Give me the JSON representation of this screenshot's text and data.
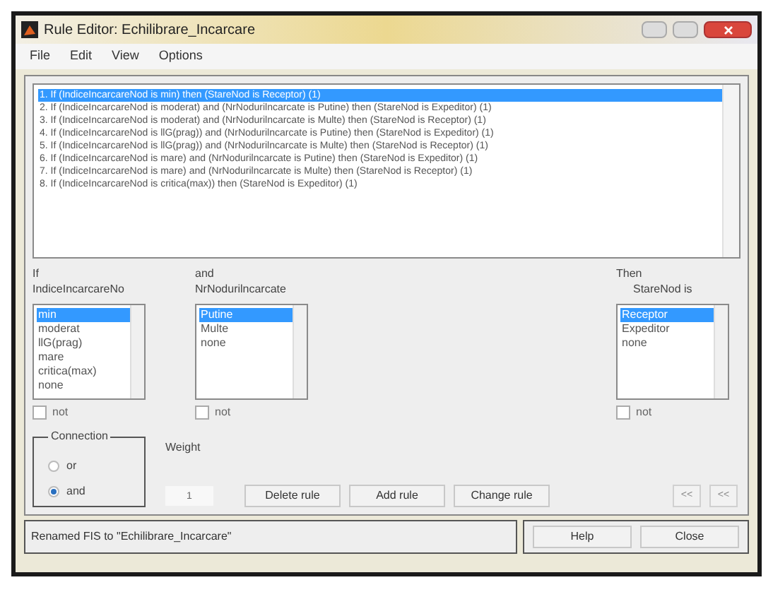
{
  "window": {
    "title": "Rule Editor: Echilibrare_Incarcare"
  },
  "menu": [
    "File",
    "Edit",
    "View",
    "Options"
  ],
  "rules": [
    {
      "text": "1. If (IndiceIncarcareNod is min) then (StareNod is Receptor) (1)",
      "selected": true
    },
    {
      "text": "2. If (IndiceIncarcareNod is moderat) and (NrNodurilncarcate is Putine) then (StareNod is Expeditor) (1)",
      "selected": false
    },
    {
      "text": "3. If (IndiceIncarcareNod is moderat) and (NrNodurilncarcate is Multe) then (StareNod is Receptor) (1)",
      "selected": false
    },
    {
      "text": "4. If (IndiceIncarcareNod is llG(prag)) and (NrNodurilncarcate is Putine) then (StareNod is Expeditor) (1)",
      "selected": false
    },
    {
      "text": "5. If (IndiceIncarcareNod is llG(prag)) and (NrNodurilncarcate is Multe) then (StareNod is Receptor) (1)",
      "selected": false
    },
    {
      "text": "6. If (IndiceIncarcareNod is mare) and (NrNodurilncarcate is Putine) then (StareNod is Expeditor) (1)",
      "selected": false
    },
    {
      "text": "7. If (IndiceIncarcareNod is mare) and (NrNodurilncarcate is Multe) then (StareNod is Receptor) (1)",
      "selected": false
    },
    {
      "text": "8. If (IndiceIncarcareNod is critica(max)) then (StareNod is Expeditor) (1)",
      "selected": false
    }
  ],
  "inputs": [
    {
      "prefix": "If",
      "name": "IndiceIncarcareNo",
      "not_label": "not",
      "not_checked": false,
      "options": [
        {
          "label": "min",
          "selected": true
        },
        {
          "label": "moderat",
          "selected": false
        },
        {
          "label": "llG(prag)",
          "selected": false
        },
        {
          "label": "mare",
          "selected": false
        },
        {
          "label": "critica(max)",
          "selected": false
        },
        {
          "label": "none",
          "selected": false
        }
      ]
    },
    {
      "prefix": "and",
      "name": "NrNodurilncarcate",
      "not_label": "not",
      "not_checked": false,
      "options": [
        {
          "label": "Putine",
          "selected": true
        },
        {
          "label": "Multe",
          "selected": false
        },
        {
          "label": "none",
          "selected": false
        }
      ]
    }
  ],
  "output": {
    "prefix": "Then",
    "name": "StareNod is",
    "not_label": "not",
    "not_checked": false,
    "options": [
      {
        "label": "Receptor",
        "selected": true
      },
      {
        "label": "Expeditor",
        "selected": false
      },
      {
        "label": "none",
        "selected": false
      }
    ]
  },
  "connection": {
    "title": "Connection",
    "options": [
      {
        "label": "or",
        "selected": false
      },
      {
        "label": "and",
        "selected": true
      }
    ]
  },
  "weight": {
    "label": "Weight",
    "value": "1"
  },
  "buttons": [
    "Delete rule",
    "Add rule",
    "Change rule"
  ],
  "nav_buttons": [
    "<<",
    "<<"
  ],
  "status": "Renamed FIS to \"Echilibrare_Incarcare\"",
  "footer_buttons": [
    "Help",
    "Close"
  ]
}
